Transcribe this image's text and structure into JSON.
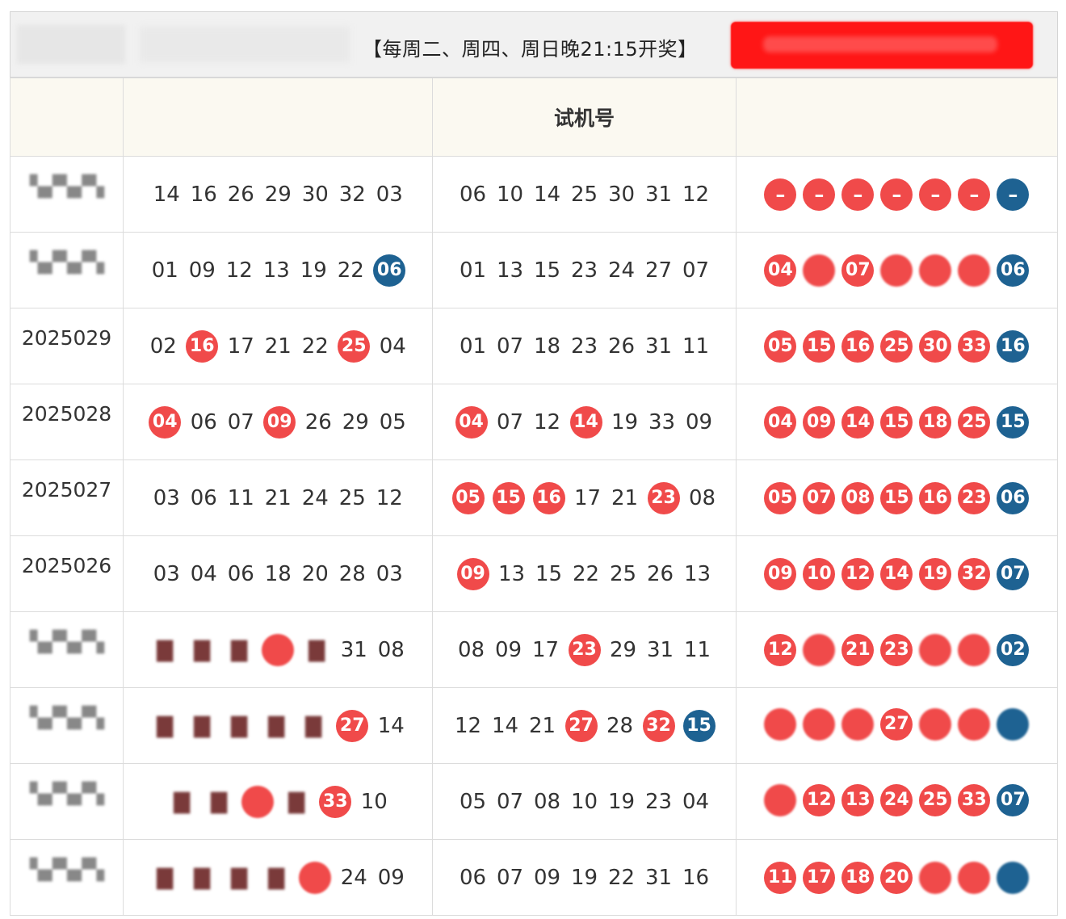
{
  "header": {
    "draw_notice": "【每周二、周四、周日晚21:15开奖】",
    "col_test_numbers": "试机号"
  },
  "colors": {
    "red_ball": "#f04a4a",
    "blue_ball": "#1e6292",
    "header_bg": "#fbf9f1",
    "banner": "#ff1616"
  },
  "rows": [
    {
      "period": "",
      "period_blurred": true,
      "draw": [
        {
          "v": "14"
        },
        {
          "v": "16"
        },
        {
          "v": "26"
        },
        {
          "v": "29"
        },
        {
          "v": "30"
        },
        {
          "v": "32"
        },
        {
          "v": "03"
        }
      ],
      "test": [
        {
          "v": "06"
        },
        {
          "v": "10"
        },
        {
          "v": "14"
        },
        {
          "v": "25"
        },
        {
          "v": "30"
        },
        {
          "v": "31"
        },
        {
          "v": "12"
        }
      ],
      "pick": [
        {
          "v": "–",
          "c": "red"
        },
        {
          "v": "–",
          "c": "red"
        },
        {
          "v": "–",
          "c": "red"
        },
        {
          "v": "–",
          "c": "red"
        },
        {
          "v": "–",
          "c": "red"
        },
        {
          "v": "–",
          "c": "red"
        },
        {
          "v": "–",
          "c": "blue"
        }
      ]
    },
    {
      "period": "",
      "period_blurred": true,
      "draw": [
        {
          "v": "01"
        },
        {
          "v": "09"
        },
        {
          "v": "12"
        },
        {
          "v": "13"
        },
        {
          "v": "19"
        },
        {
          "v": "22"
        },
        {
          "v": "06",
          "c": "blue"
        }
      ],
      "test": [
        {
          "v": "01"
        },
        {
          "v": "13"
        },
        {
          "v": "15"
        },
        {
          "v": "23"
        },
        {
          "v": "24"
        },
        {
          "v": "27"
        },
        {
          "v": "07"
        }
      ],
      "pick": [
        {
          "v": "04",
          "c": "red"
        },
        {
          "v": "",
          "c": "red",
          "b": true
        },
        {
          "v": "07",
          "c": "red"
        },
        {
          "v": "",
          "c": "red",
          "b": true
        },
        {
          "v": "",
          "c": "red",
          "b": true
        },
        {
          "v": "",
          "c": "red",
          "b": true
        },
        {
          "v": "06",
          "c": "blue"
        }
      ]
    },
    {
      "period": "2025029",
      "draw": [
        {
          "v": "02"
        },
        {
          "v": "16",
          "c": "red"
        },
        {
          "v": "17"
        },
        {
          "v": "21"
        },
        {
          "v": "22"
        },
        {
          "v": "25",
          "c": "red"
        },
        {
          "v": "04"
        }
      ],
      "test": [
        {
          "v": "01"
        },
        {
          "v": "07"
        },
        {
          "v": "18"
        },
        {
          "v": "23"
        },
        {
          "v": "26"
        },
        {
          "v": "31"
        },
        {
          "v": "11"
        }
      ],
      "pick": [
        {
          "v": "05",
          "c": "red"
        },
        {
          "v": "15",
          "c": "red"
        },
        {
          "v": "16",
          "c": "red"
        },
        {
          "v": "25",
          "c": "red"
        },
        {
          "v": "30",
          "c": "red"
        },
        {
          "v": "33",
          "c": "red"
        },
        {
          "v": "16",
          "c": "blue"
        }
      ]
    },
    {
      "period": "2025028",
      "draw": [
        {
          "v": "04",
          "c": "red"
        },
        {
          "v": "06"
        },
        {
          "v": "07"
        },
        {
          "v": "09",
          "c": "red"
        },
        {
          "v": "26"
        },
        {
          "v": "29"
        },
        {
          "v": "05"
        }
      ],
      "test": [
        {
          "v": "04",
          "c": "red"
        },
        {
          "v": "07"
        },
        {
          "v": "12"
        },
        {
          "v": "14",
          "c": "red"
        },
        {
          "v": "19"
        },
        {
          "v": "33"
        },
        {
          "v": "09"
        }
      ],
      "pick": [
        {
          "v": "04",
          "c": "red"
        },
        {
          "v": "09",
          "c": "red"
        },
        {
          "v": "14",
          "c": "red"
        },
        {
          "v": "15",
          "c": "red"
        },
        {
          "v": "18",
          "c": "red"
        },
        {
          "v": "25",
          "c": "red"
        },
        {
          "v": "15",
          "c": "blue"
        }
      ]
    },
    {
      "period": "2025027",
      "draw": [
        {
          "v": "03"
        },
        {
          "v": "06"
        },
        {
          "v": "11"
        },
        {
          "v": "21"
        },
        {
          "v": "24"
        },
        {
          "v": "25"
        },
        {
          "v": "12"
        }
      ],
      "test": [
        {
          "v": "05",
          "c": "red"
        },
        {
          "v": "15",
          "c": "red"
        },
        {
          "v": "16",
          "c": "red"
        },
        {
          "v": "17"
        },
        {
          "v": "21"
        },
        {
          "v": "23",
          "c": "red"
        },
        {
          "v": "08"
        }
      ],
      "pick": [
        {
          "v": "05",
          "c": "red"
        },
        {
          "v": "07",
          "c": "red"
        },
        {
          "v": "08",
          "c": "red"
        },
        {
          "v": "15",
          "c": "red"
        },
        {
          "v": "16",
          "c": "red"
        },
        {
          "v": "23",
          "c": "red"
        },
        {
          "v": "06",
          "c": "blue"
        }
      ]
    },
    {
      "period": "2025026",
      "draw": [
        {
          "v": "03"
        },
        {
          "v": "04"
        },
        {
          "v": "06"
        },
        {
          "v": "18"
        },
        {
          "v": "20"
        },
        {
          "v": "28"
        },
        {
          "v": "03"
        }
      ],
      "test": [
        {
          "v": "09",
          "c": "red"
        },
        {
          "v": "13"
        },
        {
          "v": "15"
        },
        {
          "v": "22"
        },
        {
          "v": "25"
        },
        {
          "v": "26"
        },
        {
          "v": "13"
        }
      ],
      "pick": [
        {
          "v": "09",
          "c": "red"
        },
        {
          "v": "10",
          "c": "red"
        },
        {
          "v": "12",
          "c": "red"
        },
        {
          "v": "14",
          "c": "red"
        },
        {
          "v": "19",
          "c": "red"
        },
        {
          "v": "32",
          "c": "red"
        },
        {
          "v": "07",
          "c": "blue"
        }
      ]
    },
    {
      "period": "",
      "period_blurred": true,
      "draw": [
        {
          "v": "",
          "b": true
        },
        {
          "v": "",
          "b": true
        },
        {
          "v": "",
          "b": true
        },
        {
          "v": "",
          "b": true,
          "c": "red"
        },
        {
          "v": "",
          "b": true
        },
        {
          "v": "31"
        },
        {
          "v": "08"
        }
      ],
      "test": [
        {
          "v": "08"
        },
        {
          "v": "09"
        },
        {
          "v": "17"
        },
        {
          "v": "23",
          "c": "red"
        },
        {
          "v": "29"
        },
        {
          "v": "31"
        },
        {
          "v": "11"
        }
      ],
      "pick": [
        {
          "v": "12",
          "c": "red"
        },
        {
          "v": "",
          "c": "red",
          "b": true
        },
        {
          "v": "21",
          "c": "red"
        },
        {
          "v": "23",
          "c": "red"
        },
        {
          "v": "",
          "c": "red",
          "b": true
        },
        {
          "v": "",
          "c": "red",
          "b": true
        },
        {
          "v": "02",
          "c": "blue"
        }
      ]
    },
    {
      "period": "",
      "period_blurred": true,
      "draw": [
        {
          "v": "",
          "b": true
        },
        {
          "v": "",
          "b": true
        },
        {
          "v": "",
          "b": true
        },
        {
          "v": "",
          "b": true
        },
        {
          "v": "",
          "b": true
        },
        {
          "v": "27",
          "c": "red"
        },
        {
          "v": "14"
        }
      ],
      "test": [
        {
          "v": "12"
        },
        {
          "v": "14"
        },
        {
          "v": "21"
        },
        {
          "v": "27",
          "c": "red"
        },
        {
          "v": "28"
        },
        {
          "v": "32",
          "c": "red"
        },
        {
          "v": "15",
          "c": "blue"
        }
      ],
      "pick": [
        {
          "v": "",
          "c": "red",
          "b": true
        },
        {
          "v": "",
          "c": "red",
          "b": true
        },
        {
          "v": "",
          "c": "red",
          "b": true
        },
        {
          "v": "27",
          "c": "red"
        },
        {
          "v": "",
          "c": "red",
          "b": true
        },
        {
          "v": "",
          "c": "red",
          "b": true
        },
        {
          "v": "",
          "c": "blue",
          "b": true
        }
      ]
    },
    {
      "period": "",
      "period_blurred": true,
      "draw": [
        {
          "v": "",
          "b": true
        },
        {
          "v": "",
          "b": true
        },
        {
          "v": "",
          "b": true,
          "c": "red"
        },
        {
          "v": "",
          "b": true
        },
        {
          "v": "33",
          "c": "red"
        },
        {
          "v": "10"
        }
      ],
      "test": [
        {
          "v": "05"
        },
        {
          "v": "07"
        },
        {
          "v": "08"
        },
        {
          "v": "10"
        },
        {
          "v": "19"
        },
        {
          "v": "23"
        },
        {
          "v": "04"
        }
      ],
      "pick": [
        {
          "v": "",
          "c": "red",
          "b": true
        },
        {
          "v": "12",
          "c": "red"
        },
        {
          "v": "13",
          "c": "red"
        },
        {
          "v": "24",
          "c": "red"
        },
        {
          "v": "25",
          "c": "red"
        },
        {
          "v": "33",
          "c": "red"
        },
        {
          "v": "07",
          "c": "blue"
        }
      ]
    },
    {
      "period": "",
      "period_blurred": true,
      "draw": [
        {
          "v": "",
          "b": true
        },
        {
          "v": "",
          "b": true
        },
        {
          "v": "",
          "b": true
        },
        {
          "v": "",
          "b": true
        },
        {
          "v": "",
          "b": true,
          "c": "red"
        },
        {
          "v": "24"
        },
        {
          "v": "09"
        }
      ],
      "test": [
        {
          "v": "06"
        },
        {
          "v": "07"
        },
        {
          "v": "09"
        },
        {
          "v": "19"
        },
        {
          "v": "22"
        },
        {
          "v": "31"
        },
        {
          "v": "16"
        }
      ],
      "pick": [
        {
          "v": "11",
          "c": "red"
        },
        {
          "v": "17",
          "c": "red"
        },
        {
          "v": "18",
          "c": "red"
        },
        {
          "v": "20",
          "c": "red"
        },
        {
          "v": "",
          "c": "red",
          "b": true
        },
        {
          "v": "",
          "c": "red",
          "b": true
        },
        {
          "v": "",
          "c": "blue",
          "b": true
        }
      ]
    }
  ]
}
